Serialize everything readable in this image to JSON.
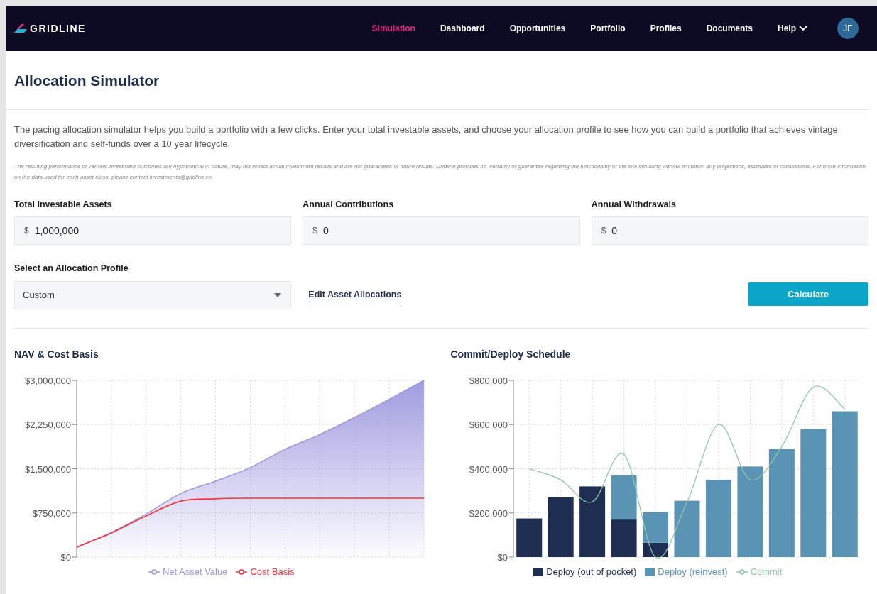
{
  "nav": {
    "logo": "GRIDLINE",
    "items": [
      {
        "label": "Simulation",
        "selected": true,
        "kind": "link"
      },
      {
        "label": "Dashboard",
        "selected": false,
        "kind": "link"
      },
      {
        "label": "Opportunities",
        "selected": false,
        "kind": "link"
      },
      {
        "label": "Portfolio",
        "selected": false,
        "kind": "link"
      },
      {
        "label": "Profiles",
        "selected": false,
        "kind": "link"
      },
      {
        "label": "Documents",
        "selected": false,
        "kind": "link"
      },
      {
        "label": "Help",
        "selected": false,
        "kind": "dropdown"
      }
    ],
    "avatar": "JF"
  },
  "page": {
    "title": "Allocation Simulator",
    "description": "The pacing allocation simulator helps you build a portfolio with a few clicks. Enter your total investable assets, and choose your allocation profile to see how you can build a portfolio that achieves vintage diversification and self-funds over a 10 year lifecycle.",
    "disclaimer": "The resulting performance of various investment outcomes are hypothetical in nature, may not reflect actual investment results and are not guarantees of future results. Gridline provides no warranty or guarantee regarding the functionality of the tool including without limitation any projections, estimates or calculations. For more information on the data used for each asset class, please contact investments@gridline.co."
  },
  "fields": [
    {
      "label": "Total Investable Assets",
      "prefix": "$",
      "value": "1,000,000"
    },
    {
      "label": "Annual Contributions",
      "prefix": "$",
      "value": "0"
    },
    {
      "label": "Annual Withdrawals",
      "prefix": "$",
      "value": "0"
    }
  ],
  "profile": {
    "label": "Select an Allocation Profile",
    "value": "Custom"
  },
  "edit_link": "Edit Asset Allocations",
  "calculate_button": "Calculate",
  "charts": [
    {
      "title": "NAV & Cost Basis",
      "chart_data": {
        "type": "area",
        "grid": true,
        "ylim": [
          0,
          3000000
        ],
        "yticks": [
          {
            "value": 0,
            "label": "$0"
          },
          {
            "value": 750000,
            "label": "$750,000"
          },
          {
            "value": 1500000,
            "label": "$1,500,000"
          },
          {
            "value": 2250000,
            "label": "$2,250,000"
          },
          {
            "value": 3000000,
            "label": "$3,000,000"
          }
        ],
        "series": [
          {
            "name": "Net Asset Value",
            "color": "#9b96dd",
            "type": "area",
            "values": [
              170000,
              420000,
              730000,
              1080000,
              1290000,
              1520000,
              1830000,
              2080000,
              2370000,
              2680000,
              3000000
            ]
          },
          {
            "name": "Cost Basis",
            "color": "#f0363f",
            "type": "line",
            "values": [
              170000,
              410000,
              700000,
              950000,
              990000,
              1000000,
              1000000,
              1000000,
              1000000,
              1000000,
              1000000
            ]
          }
        ]
      }
    },
    {
      "title": "Commit/Deploy Schedule",
      "chart_data": {
        "type": "bar",
        "stacked": true,
        "grid": true,
        "ylim": [
          0,
          800000
        ],
        "yticks": [
          {
            "value": 0,
            "label": "$0"
          },
          {
            "value": 200000,
            "label": "$200,000"
          },
          {
            "value": 400000,
            "label": "$400,000"
          },
          {
            "value": 600000,
            "label": "$600,000"
          },
          {
            "value": 800000,
            "label": "$800,000"
          }
        ],
        "series": [
          {
            "name": "Deploy (out of pocket)",
            "color": "#1e2d52",
            "type": "bar",
            "values": [
              175000,
              270000,
              320000,
              170000,
              65000,
              0,
              0,
              0,
              0,
              0,
              0
            ]
          },
          {
            "name": "Deploy (reinvest)",
            "color": "#5b93b5",
            "type": "bar",
            "values": [
              0,
              0,
              0,
              200000,
              140000,
              255000,
              350000,
              410000,
              490000,
              580000,
              660000
            ]
          },
          {
            "name": "Commit",
            "color": "#8fc9a8",
            "type": "line",
            "values": [
              400000,
              350000,
              250000,
              465000,
              0,
              250000,
              600000,
              350000,
              500000,
              770000,
              670000
            ]
          }
        ]
      }
    }
  ]
}
